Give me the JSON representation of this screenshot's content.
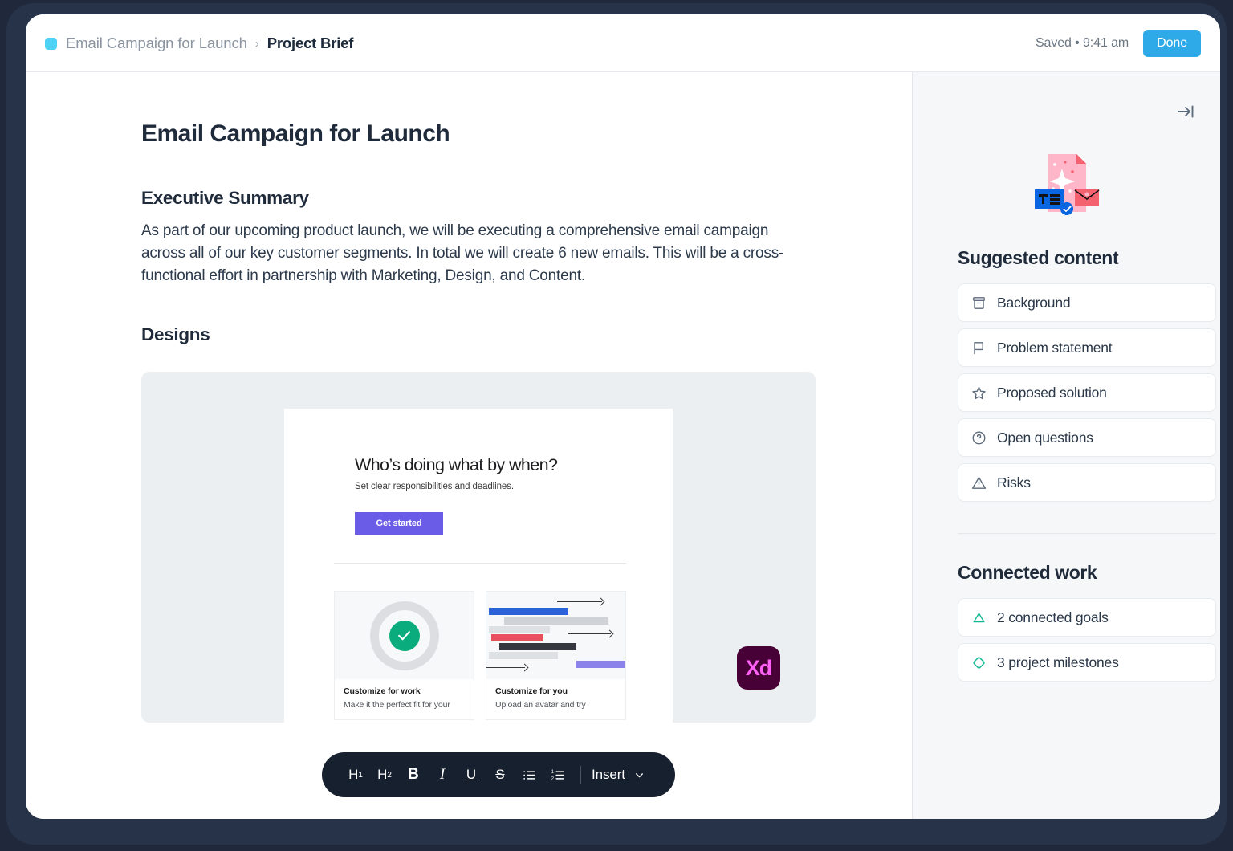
{
  "header": {
    "breadcrumb": {
      "swatch_color": "#4ed2f5",
      "parent": "Email Campaign for Launch",
      "separator": "›",
      "current": "Project Brief"
    },
    "saved_status": "Saved • 9:41 am",
    "done_label": "Done",
    "done_color": "#2eaae8"
  },
  "document": {
    "title": "Email Campaign for Launch",
    "sections": [
      {
        "heading": "Executive Summary",
        "paragraph": "As part of our upcoming product launch, we will be executing a comprehensive email campaign across all of our key customer segments. In total we will create 6 new emails. This will be a cross-functional effort in partnership with Marketing, Design, and Content."
      },
      {
        "heading": "Designs"
      }
    ]
  },
  "embed": {
    "app_badge": "Xd",
    "badge_bg": "#470137",
    "badge_fg": "#ff61f6",
    "preview": {
      "headline": "Who’s doing what by when?",
      "subhead": "Set clear responsibilities and deadlines.",
      "cta_label": "Get started",
      "cta_color": "#6b5ce7",
      "cards": [
        {
          "title": "Customize for work",
          "text": "Make it the perfect fit for your",
          "thumb": "donut-check-thumb",
          "accent": "#0aab7c"
        },
        {
          "title": "Customize for you",
          "text": "Upload an avatar and try",
          "thumb": "timeline-bars-thumb",
          "bar_colors": [
            "#2b62d9",
            "#cfd3d7",
            "#e8505f",
            "#35393f",
            "#dde1e4",
            "#8b82ea"
          ]
        }
      ]
    }
  },
  "toolbar": {
    "buttons": [
      {
        "name": "heading-1",
        "label": "H",
        "sub": "1"
      },
      {
        "name": "heading-2",
        "label": "H",
        "sub": "2"
      },
      {
        "name": "bold",
        "label": "B"
      },
      {
        "name": "italic",
        "label": "I"
      },
      {
        "name": "underline",
        "label": "U"
      },
      {
        "name": "strikethrough",
        "label": "S"
      }
    ],
    "insert_label": "Insert"
  },
  "sidebar": {
    "collapse_icon": "collapse-panel-icon",
    "suggested": {
      "title": "Suggested content",
      "items": [
        {
          "label": "Background",
          "icon": "archive-box-icon"
        },
        {
          "label": "Problem statement",
          "icon": "flag-icon"
        },
        {
          "label": "Proposed solution",
          "icon": "star-icon"
        },
        {
          "label": "Open questions",
          "icon": "question-circle-icon"
        },
        {
          "label": "Risks",
          "icon": "warning-triangle-icon"
        }
      ]
    },
    "connected": {
      "title": "Connected work",
      "accent": "#14b894",
      "items": [
        {
          "label": "2 connected goals",
          "icon": "goal-triangle-icon"
        },
        {
          "label": "3 project milestones",
          "icon": "milestone-diamond-icon"
        }
      ]
    }
  }
}
